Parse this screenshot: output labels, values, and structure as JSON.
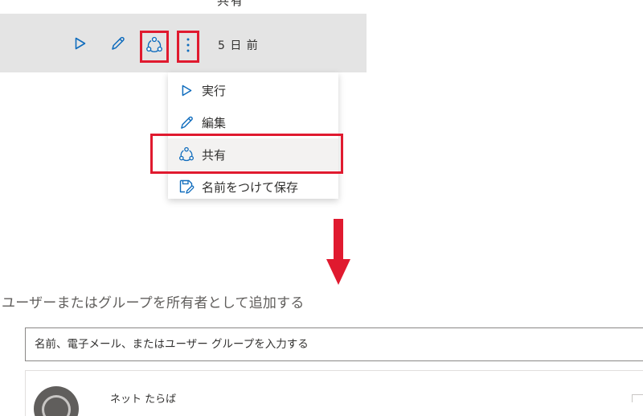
{
  "header": {
    "partial_title": "共有"
  },
  "toolbar": {
    "time_ago": "5 日 前",
    "buttons": [
      {
        "icon": "play-icon"
      },
      {
        "icon": "pencil-icon"
      },
      {
        "icon": "share-icon"
      },
      {
        "icon": "more-vertical-icon"
      }
    ]
  },
  "menu": {
    "items": [
      {
        "label": "実行",
        "icon": "play-icon"
      },
      {
        "label": "編集",
        "icon": "pencil-icon"
      },
      {
        "label": "共有",
        "icon": "share-icon"
      },
      {
        "label": "名前をつけて保存",
        "icon": "save-as-icon"
      }
    ]
  },
  "share_panel": {
    "title": "ユーザーまたはグループを所有者として追加する",
    "search_placeholder": "名前、電子メール、またはユーザー グループを入力する",
    "owner": {
      "name": "ネット たらば"
    }
  },
  "colors": {
    "accent": "#0f6cbd",
    "highlight": "#e01a2f",
    "toolbar_bg": "#e4e4e4"
  }
}
